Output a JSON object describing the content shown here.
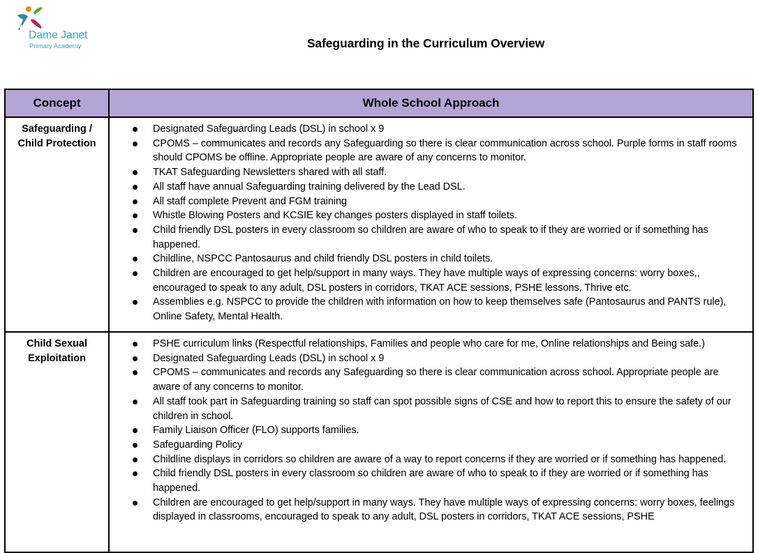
{
  "header": {
    "logo": {
      "name": "Dame Janet",
      "subtitle": "Primary  Academy",
      "colors": {
        "orange": "#f08a24",
        "green": "#5aa832",
        "teal": "#2a8aa6",
        "magenta": "#b0265a",
        "text": "#4a9fb5"
      }
    },
    "title": "Safeguarding in the Curriculum Overview"
  },
  "table": {
    "header_color": "#b3a5d5",
    "columns": [
      "Concept",
      "Whole School Approach"
    ],
    "rows": [
      {
        "concept": "Safeguarding / Child Protection",
        "items": [
          "Designated Safeguarding Leads (DSL) in school x 9",
          "CPOMS – communicates and records any Safeguarding so there is clear communication across school. Purple forms in staff rooms should CPOMS be offline. Appropriate people are aware of any concerns to monitor.",
          "TKAT Safeguarding Newsletters shared with all staff.",
          "All staff have annual Safeguarding training delivered by the Lead DSL.",
          "All staff complete Prevent and FGM training",
          "Whistle Blowing Posters and KCSIE key changes posters displayed in staff toilets.",
          "Child friendly DSL posters in every classroom so children are aware of who to speak to if they are worried or if something has happened.",
          "Childline, NSPCC Pantosaurus and child friendly DSL posters in child toilets.",
          "Children are encouraged to get help/support in many ways. They have multiple ways of expressing concerns: worry boxes,, encouraged to speak to any adult, DSL posters in corridors, TKAT ACE sessions,  PSHE lessons, Thrive etc.",
          "Assemblies e.g. NSPCC to provide the children with information on how to keep themselves safe (Pantosaurus and PANTS rule), Online Safety, Mental Health."
        ]
      },
      {
        "concept": "Child Sexual Exploitation",
        "items": [
          "PSHE curriculum links (Respectful relationships, Families and people who care for me, Online relationships and Being safe.)",
          "Designated Safeguarding Leads (DSL) in school x 9",
          "CPOMS – communicates and records any Safeguarding so there is clear communication across school. Appropriate people are aware of any concerns to monitor.",
          "All staff took part in Safeguarding training so staff can spot possible signs of CSE and how to report this to ensure the safety of our children in school.",
          "Family Liaison Officer (FLO) supports families.",
          " Safeguarding Policy",
          "Childline displays in corridors so children are aware of a way to report concerns if they are worried or if something has happened.",
          "Child friendly DSL posters in every classroom so children are aware of who to speak to if they are worried or if something has happened.",
          "Children are encouraged to get help/support in many ways. They have multiple ways of expressing concerns: worry boxes, feelings displayed in classrooms, encouraged to speak to any adult, DSL posters in corridors, TKAT ACE sessions,  PSHE"
        ]
      }
    ]
  }
}
